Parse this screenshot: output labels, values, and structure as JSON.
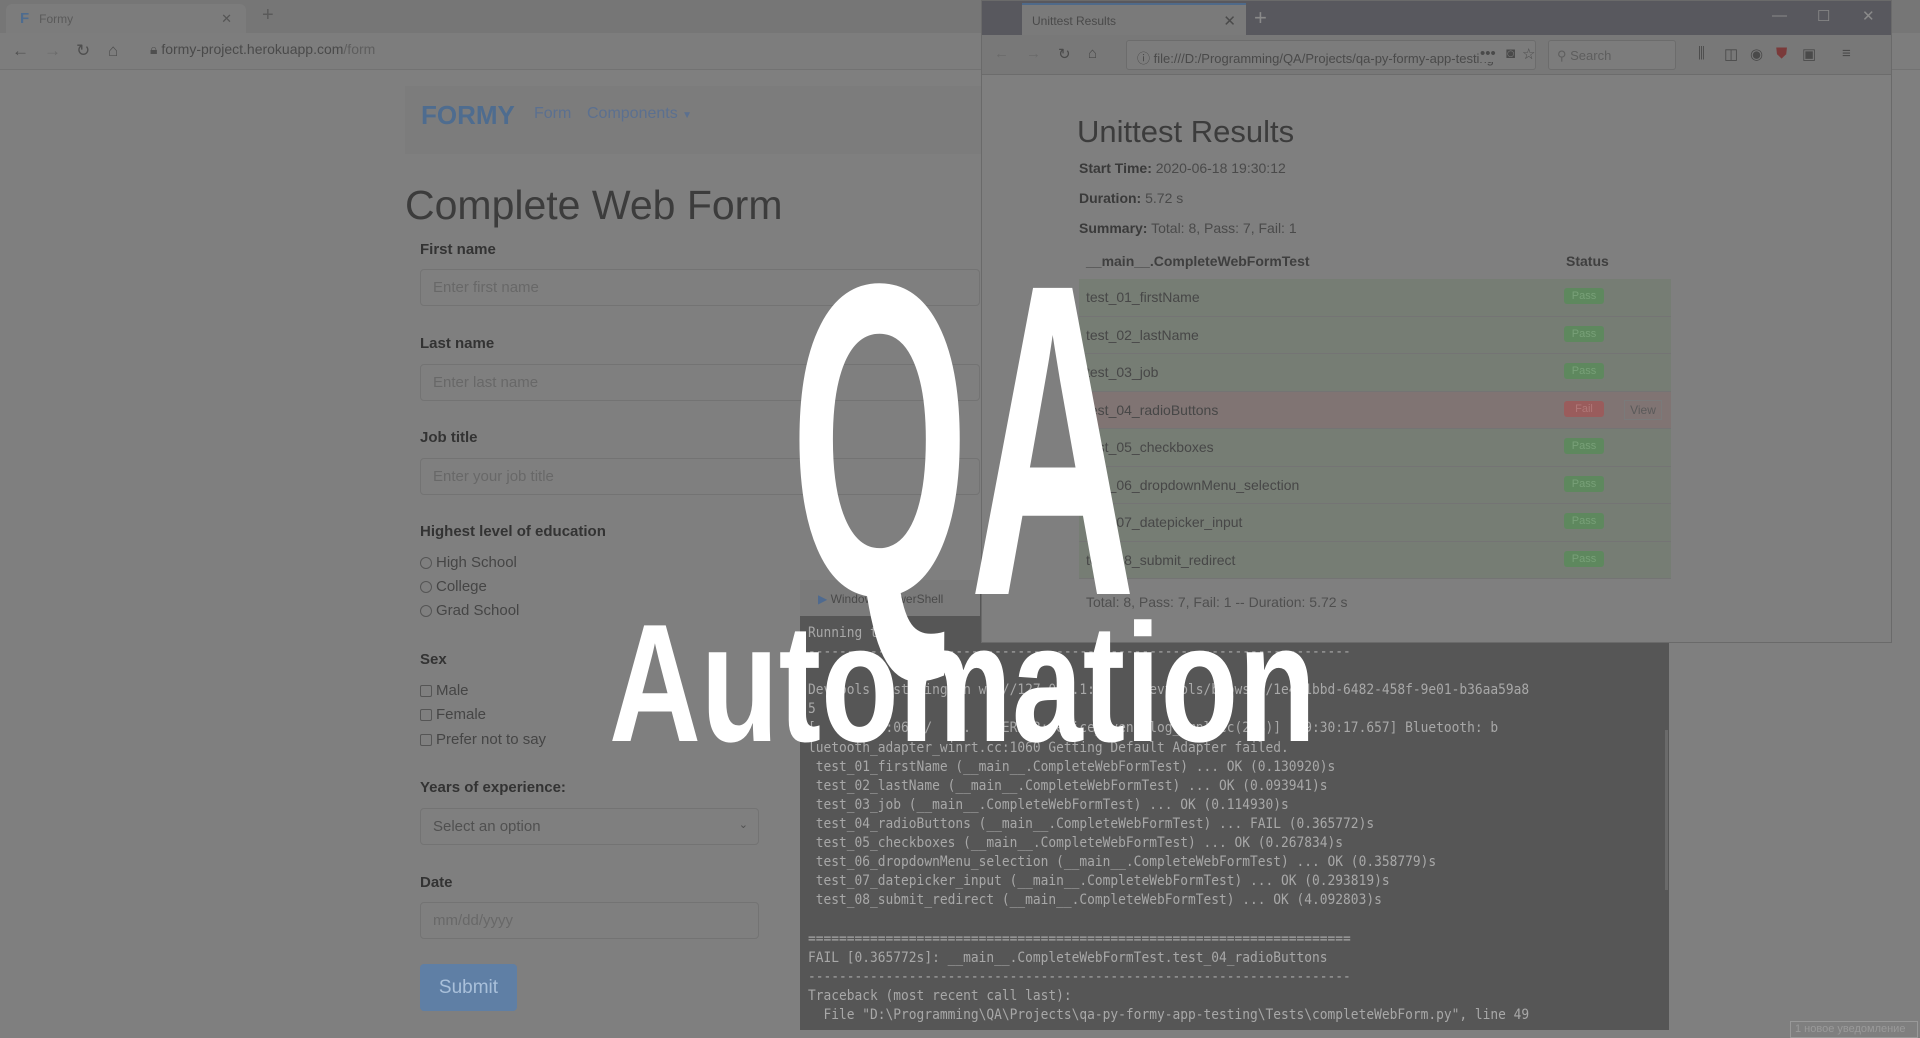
{
  "chrome": {
    "tab_title": "Formy",
    "favicon": "F",
    "url_host": "formy-project.herokuapp.com",
    "url_path": "/form"
  },
  "formy": {
    "brand": "FORMY",
    "nav": [
      "Form",
      "Components"
    ],
    "title": "Complete Web Form",
    "fields": {
      "first_name": {
        "label": "First name",
        "placeholder": "Enter first name"
      },
      "last_name": {
        "label": "Last name",
        "placeholder": "Enter last name"
      },
      "job_title": {
        "label": "Job title",
        "placeholder": "Enter your job title"
      },
      "education": {
        "label": "Highest level of education",
        "options": [
          "High School",
          "College",
          "Grad School"
        ]
      },
      "sex": {
        "label": "Sex",
        "options": [
          "Male",
          "Female",
          "Prefer not to say"
        ]
      },
      "experience": {
        "label": "Years of experience:",
        "selected": "Select an option"
      },
      "date": {
        "label": "Date",
        "placeholder": "mm/dd/yyyy"
      }
    },
    "submit": "Submit"
  },
  "firefox": {
    "tab_title": "Unittest Results",
    "url": "file:///D:/Programming/QA/Projects/qa-py-formy-app-testing",
    "search_placeholder": "Search"
  },
  "report": {
    "title": "Unittest Results",
    "start_time_label": "Start Time:",
    "start_time": "2020-06-18 19:30:12",
    "duration_label": "Duration:",
    "duration": "5.72 s",
    "summary_label": "Summary:",
    "summary": "Total: 8, Pass: 7, Fail: 1",
    "header_class": "__main__.CompleteWebFormTest",
    "header_status": "Status",
    "rows": [
      {
        "name": "test_01_firstName",
        "status": "Pass"
      },
      {
        "name": "test_02_lastName",
        "status": "Pass"
      },
      {
        "name": "test_03_job",
        "status": "Pass"
      },
      {
        "name": "test_04_radioButtons",
        "status": "Fail",
        "action": "View"
      },
      {
        "name": "test_05_checkboxes",
        "status": "Pass"
      },
      {
        "name": "test_06_dropdownMenu_selection",
        "status": "Pass"
      },
      {
        "name": "test_07_datepicker_input",
        "status": "Pass"
      },
      {
        "name": "test_08_submit_redirect",
        "status": "Pass"
      }
    ],
    "footer": "Total: 8, Pass: 7, Fail: 1 -- Duration: 5.72 s"
  },
  "powershell": {
    "title": "Windows PowerShell",
    "lines": [
      "Running tests...",
      "----------------------------------------------------------------------",
      "",
      "DevTools listening on ws://127.0.0.1:5    /devtools/browser/1e4e1bbd-6482-458f-9e01-b36aa59a8",
      "5",
      "[    :    :0618/    .   :ERROR:device_event_log_impl.cc(208)] [19:30:17.657] Bluetooth: b",
      "luetooth_adapter_winrt.cc:1060 Getting Default Adapter failed.",
      " test_01_firstName (__main__.CompleteWebFormTest) ... OK (0.130920)s",
      " test_02_lastName (__main__.CompleteWebFormTest) ... OK (0.093941)s",
      " test_03_job (__main__.CompleteWebFormTest) ... OK (0.114930)s",
      " test_04_radioButtons (__main__.CompleteWebFormTest) ... FAIL (0.365772)s",
      " test_05_checkboxes (__main__.CompleteWebFormTest) ... OK (0.267834)s",
      " test_06_dropdownMenu_selection (__main__.CompleteWebFormTest) ... OK (0.358779)s",
      " test_07_datepicker_input (__main__.CompleteWebFormTest) ... OK (0.293819)s",
      " test_08_submit_redirect (__main__.CompleteWebFormTest) ... OK (4.092803)s",
      "",
      "======================================================================",
      "FAIL [0.365772s]: __main__.CompleteWebFormTest.test_04_radioButtons",
      "----------------------------------------------------------------------",
      "Traceback (most recent call last):",
      "  File \"D:\\Programming\\QA\\Projects\\qa-py-formy-app-testing\\Tests\\completeWebForm.py\", line 49"
    ]
  },
  "taskbar": {
    "notification": "1 новое уведомление"
  },
  "overlay": {
    "line1": "QA",
    "line2": "Automation",
    "color": "#ffffff"
  }
}
